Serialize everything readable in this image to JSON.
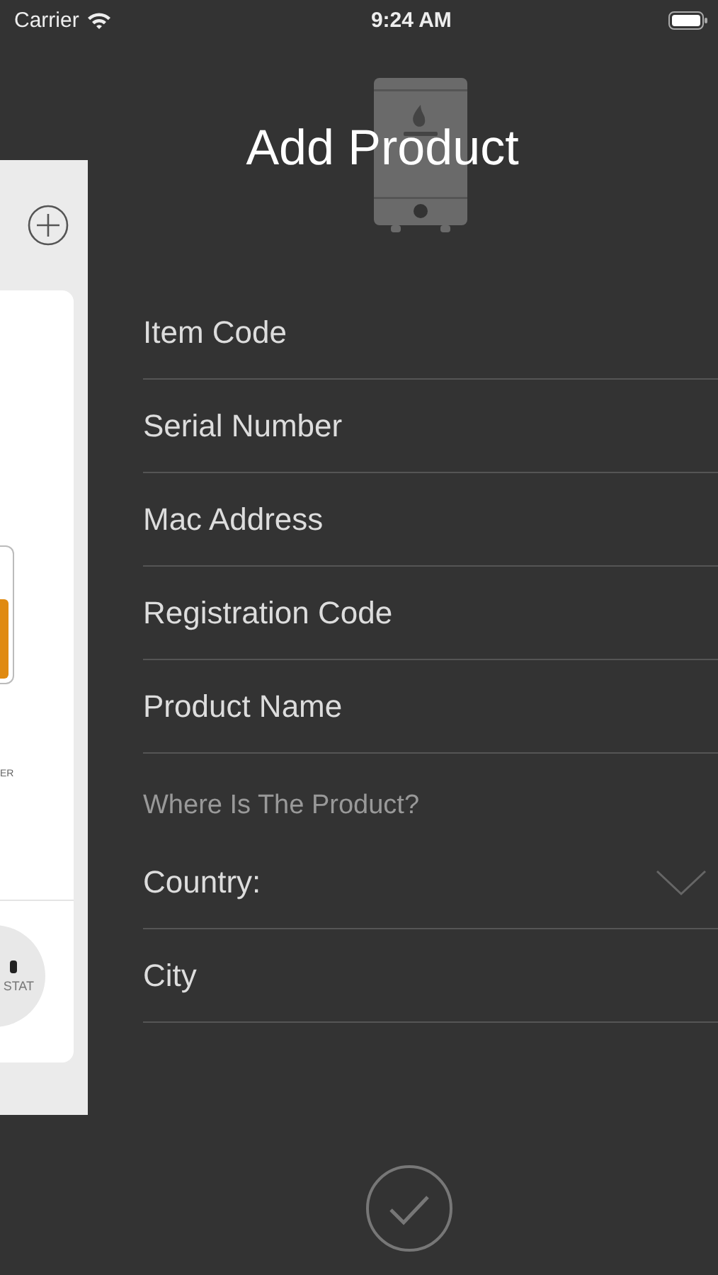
{
  "status_bar": {
    "carrier": "Carrier",
    "time": "9:24 AM"
  },
  "side_panel": {
    "labels": [
      "ER",
      "STAT"
    ]
  },
  "title": "Add Product",
  "fields": [
    {
      "kind": "text",
      "placeholder": "Item Code"
    },
    {
      "kind": "text",
      "placeholder": "Serial Number"
    },
    {
      "kind": "text",
      "placeholder": "Mac Address"
    },
    {
      "kind": "text",
      "placeholder": "Registration Code"
    },
    {
      "kind": "text",
      "placeholder": "Product Name"
    },
    {
      "kind": "heading",
      "text": "Where Is The Product?"
    },
    {
      "kind": "dropdown",
      "placeholder": "Country:"
    },
    {
      "kind": "text",
      "placeholder": "City"
    }
  ]
}
